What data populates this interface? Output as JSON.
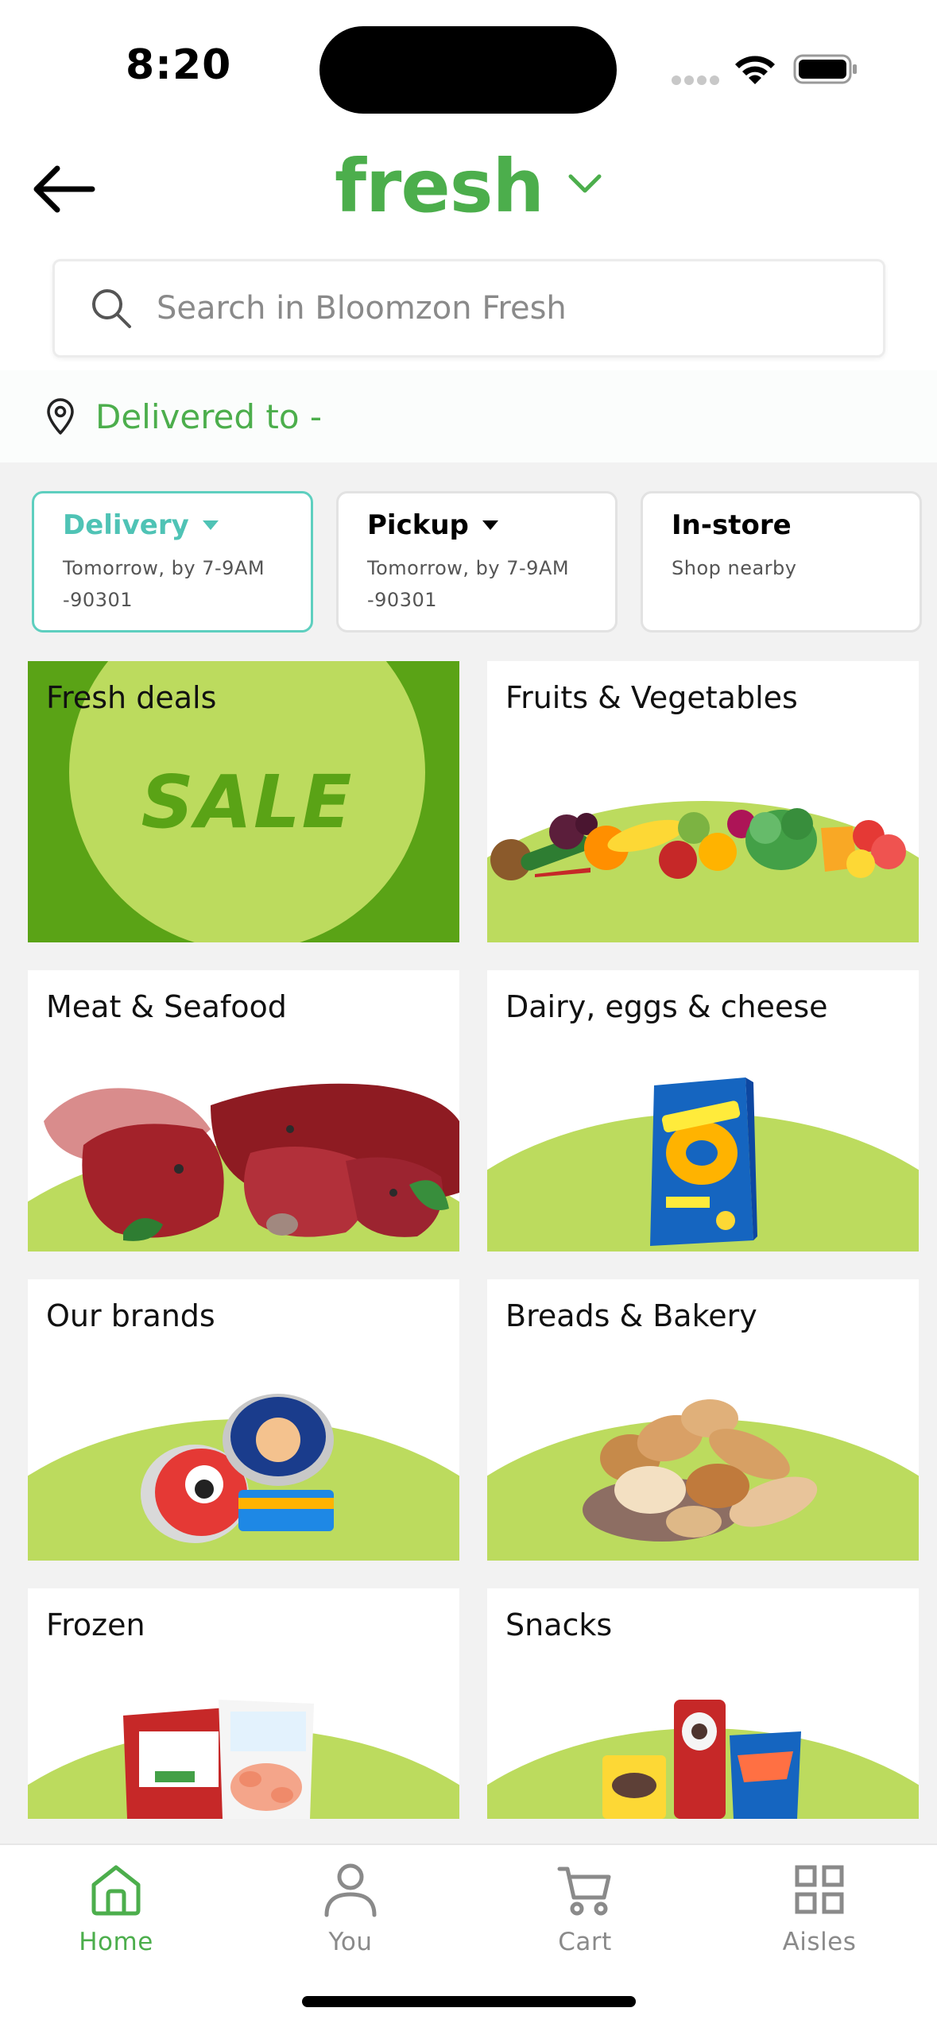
{
  "status_bar": {
    "time": "8:20"
  },
  "header": {
    "brand": "fresh",
    "search_placeholder": "Search in Bloomzon Fresh",
    "delivered_to": "Delivered to -"
  },
  "modes": [
    {
      "title": "Delivery",
      "line1": "Tomorrow, by 7-9AM",
      "line2": "-90301"
    },
    {
      "title": "Pickup",
      "line1": "Tomorrow, by 7-9AM",
      "line2": "-90301"
    },
    {
      "title": "In-store",
      "line1": "Shop nearby",
      "line2": ""
    }
  ],
  "categories": [
    {
      "label": "Fresh deals",
      "badge": "SALE"
    },
    {
      "label": "Fruits & Vegetables"
    },
    {
      "label": "Meat & Seafood"
    },
    {
      "label": "Dairy, eggs & cheese"
    },
    {
      "label": "Our brands"
    },
    {
      "label": "Breads & Bakery"
    },
    {
      "label": "Frozen"
    },
    {
      "label": "Snacks"
    }
  ],
  "tabbar": [
    {
      "label": "Home",
      "icon": "home-icon"
    },
    {
      "label": "You",
      "icon": "person-icon"
    },
    {
      "label": "Cart",
      "icon": "cart-icon"
    },
    {
      "label": "Aisles",
      "icon": "grid-icon"
    }
  ],
  "colors": {
    "brand_green": "#4cae4c",
    "lime": "#bcdb5e",
    "deals_green": "#5aa316",
    "teal": "#5ecfbf"
  }
}
